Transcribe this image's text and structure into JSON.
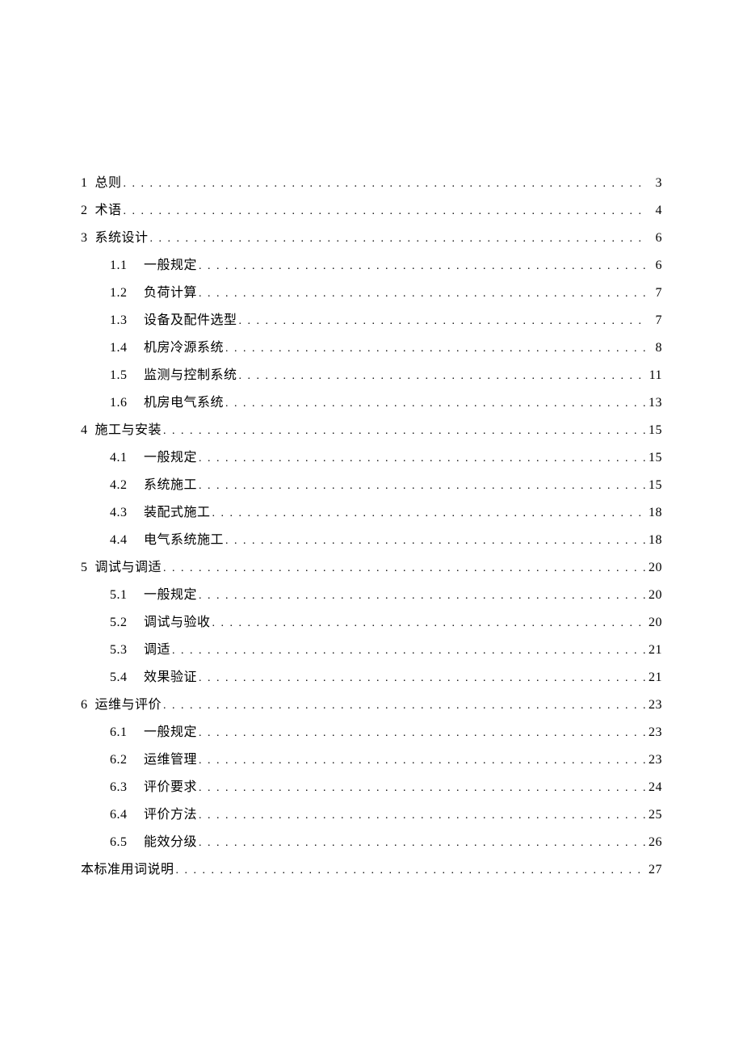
{
  "toc": [
    {
      "level": 0,
      "num": "1",
      "title": "总则",
      "page": "3"
    },
    {
      "level": 0,
      "num": "2",
      "title": "术语",
      "page": "4"
    },
    {
      "level": 0,
      "num": "3",
      "title": "系统设计",
      "page": "6"
    },
    {
      "level": 1,
      "num": "1.1",
      "title": "一般规定",
      "page": "6"
    },
    {
      "level": 1,
      "num": "1.2",
      "title": "负荷计算",
      "page": "7"
    },
    {
      "level": 1,
      "num": "1.3",
      "title": "设备及配件选型",
      "page": "7"
    },
    {
      "level": 1,
      "num": "1.4",
      "title": "机房冷源系统",
      "page": "8"
    },
    {
      "level": 1,
      "num": "1.5",
      "title": "监测与控制系统",
      "page": "11"
    },
    {
      "level": 1,
      "num": "1.6",
      "title": "机房电气系统",
      "page": "13"
    },
    {
      "level": 0,
      "num": "4",
      "title": "施工与安装",
      "page": "15"
    },
    {
      "level": 1,
      "num": "4.1",
      "title": "一般规定",
      "page": "15"
    },
    {
      "level": 1,
      "num": "4.2",
      "title": "系统施工",
      "page": "15"
    },
    {
      "level": 1,
      "num": "4.3",
      "title": "装配式施工",
      "page": "18"
    },
    {
      "level": 1,
      "num": "4.4",
      "title": "电气系统施工",
      "page": "18"
    },
    {
      "level": 0,
      "num": "5",
      "title": "调试与调适",
      "page": "20"
    },
    {
      "level": 1,
      "num": "5.1",
      "title": "一般规定",
      "page": "20"
    },
    {
      "level": 1,
      "num": "5.2",
      "title": "调试与验收",
      "page": "20"
    },
    {
      "level": 1,
      "num": "5.3",
      "title": "调适",
      "page": "21"
    },
    {
      "level": 1,
      "num": "5.4",
      "title": "效果验证",
      "page": "21"
    },
    {
      "level": 0,
      "num": "6",
      "title": "运维与评价",
      "page": "23"
    },
    {
      "level": 1,
      "num": "6.1",
      "title": "一般规定",
      "page": "23"
    },
    {
      "level": 1,
      "num": "6.2",
      "title": "运维管理",
      "page": "23"
    },
    {
      "level": 1,
      "num": "6.3",
      "title": "评价要求",
      "page": "24"
    },
    {
      "level": 1,
      "num": "6.4",
      "title": "评价方法",
      "page": "25"
    },
    {
      "level": 1,
      "num": "6.5",
      "title": "能效分级",
      "page": "26"
    },
    {
      "level": 0,
      "num": "",
      "title": "本标准用词说明",
      "page": "27"
    }
  ],
  "space_after_num_top": "  "
}
